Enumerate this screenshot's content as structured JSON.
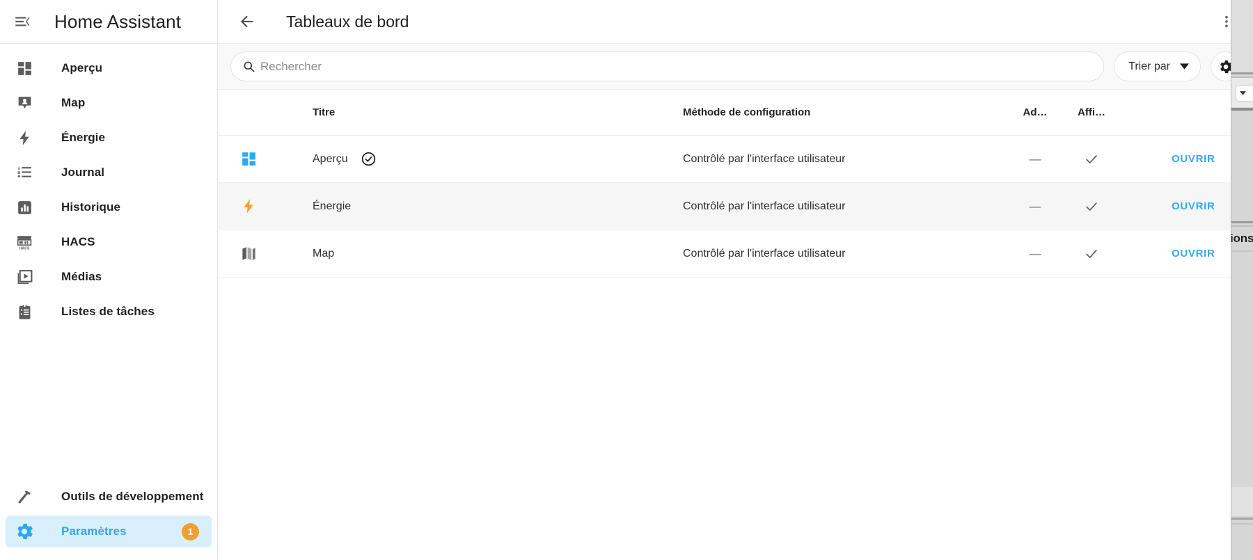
{
  "sidebar": {
    "app_title": "Home Assistant",
    "menu_icon": "menu-collapse-icon",
    "items": [
      {
        "label": "Aperçu",
        "icon": "view-dashboard-icon",
        "active": false,
        "badge": null
      },
      {
        "label": "Map",
        "icon": "map-marker-icon",
        "active": false,
        "badge": null
      },
      {
        "label": "Énergie",
        "icon": "lightning-bolt-icon",
        "active": false,
        "badge": null
      },
      {
        "label": "Journal",
        "icon": "format-list-icon",
        "active": false,
        "badge": null
      },
      {
        "label": "Historique",
        "icon": "chart-box-icon",
        "active": false,
        "badge": null
      },
      {
        "label": "HACS",
        "icon": "hacs-store-icon",
        "active": false,
        "badge": null
      },
      {
        "label": "Médias",
        "icon": "media-play-icon",
        "active": false,
        "badge": null
      },
      {
        "label": "Listes de tâches",
        "icon": "clipboard-list-icon",
        "active": false,
        "badge": null
      }
    ],
    "bottom_items": [
      {
        "label": "Outils de développement",
        "icon": "hammer-wrench-icon",
        "active": false,
        "badge": null
      },
      {
        "label": "Paramètres",
        "icon": "cog-icon",
        "active": true,
        "badge": "1"
      }
    ]
  },
  "toolbar": {
    "back_icon": "arrow-left-icon",
    "title": "Tableaux de bord",
    "overflow_icon": "dots-vertical-icon"
  },
  "search": {
    "icon": "search-icon",
    "value": "",
    "placeholder": "Rechercher"
  },
  "controls": {
    "sort_label": "Trier par",
    "sort_chevron_icon": "chevron-down-icon",
    "settings_icon": "gear-icon"
  },
  "table": {
    "headers": {
      "icon": "",
      "title": "Titre",
      "method": "Méthode de configuration",
      "admin": "Ad…",
      "show": "Affi…",
      "action": ""
    },
    "rows": [
      {
        "icon": "view-dashboard-icon",
        "icon_color": "#29a9f0",
        "title": "Aperçu",
        "default_badge_icon": "check-circle-outline-icon",
        "method": "Contrôlé par l'interface utilisateur",
        "admin": "—",
        "show": "check-icon",
        "action": "OUVRIR",
        "hover": false
      },
      {
        "icon": "lightning-bolt-icon",
        "icon_color": "#f4a22a",
        "title": "Énergie",
        "default_badge_icon": null,
        "method": "Contrôlé par l'interface utilisateur",
        "admin": "—",
        "show": "check-icon",
        "action": "OUVRIR",
        "hover": true
      },
      {
        "icon": "map-outline-icon",
        "icon_color": "#5c5c5c",
        "title": "Map",
        "default_badge_icon": null,
        "method": "Contrôlé par l'interface utilisateur",
        "admin": "—",
        "show": "check-icon",
        "action": "OUVRIR",
        "hover": false
      }
    ]
  },
  "background_window": {
    "visible_text": "ions"
  },
  "colors": {
    "accent_blue": "#29a9f0",
    "link_blue": "#35aaf0",
    "active_bg": "#daeffc",
    "badge_orange": "#f0a033",
    "energy_orange": "#f4a22a",
    "text_primary": "#212121",
    "row_hover": "#f6f6f6",
    "toolbar_bg": "#f9f9f9"
  }
}
